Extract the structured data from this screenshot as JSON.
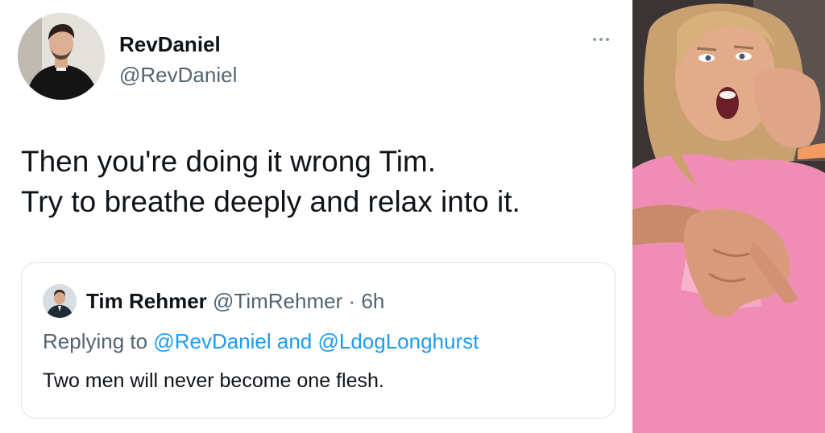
{
  "tweet": {
    "author": {
      "display_name": "RevDaniel",
      "handle": "@RevDaniel",
      "avatar_icon": "profile-photo-priest"
    },
    "more_icon": "ellipsis-icon",
    "text_lines": [
      "Then you're doing it wrong Tim.",
      "Try to breathe deeply and relax into it."
    ]
  },
  "quoted_tweet": {
    "display_name": "Tim Rehmer",
    "handle": "@TimRehmer",
    "separator": " · ",
    "time": "6h",
    "replying_to_prefix": "Replying to ",
    "mention_1": "@RevDaniel",
    "conjunction": " and ",
    "mention_2": "@LdogLonghurst",
    "text": "Two men will never become one flesh."
  },
  "reaction_image": {
    "description_icon": "shocked-woman-pointing-photo"
  },
  "colors": {
    "link": "#1d9bf0",
    "secondary_text": "#536471",
    "primary_text": "#0f1419",
    "shirt_pink": "#f08db4"
  }
}
